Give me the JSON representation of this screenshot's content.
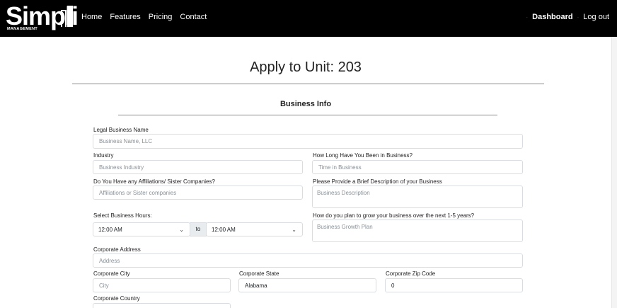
{
  "navbar": {
    "logo_text": "Simpli",
    "logo_subtext": "MANAGEMENT",
    "links": [
      "Home",
      "Features",
      "Pricing",
      "Contact"
    ],
    "dashboard_label": "Dashboard",
    "logout_label": "Log out",
    "separator": "·"
  },
  "page": {
    "title": "Apply to Unit: 203",
    "section_title": "Business Info"
  },
  "form": {
    "legal_name": {
      "label": "Legal Business Name",
      "placeholder": "Business Name, LLC"
    },
    "industry": {
      "label": "Industry",
      "placeholder": "Business Industry"
    },
    "time_in_business": {
      "label": "How Long Have You Been in Business?",
      "placeholder": "Time in Business"
    },
    "affiliations": {
      "label": "Do You Have any Affiliations/ Sister Companies?",
      "placeholder": "Affiliations or Sister companies"
    },
    "description": {
      "label": "Please Provide a Brief Description of your Business",
      "placeholder": "Business Description"
    },
    "hours": {
      "label": "Select Business Hours:",
      "open_value": "12:00 AM",
      "to_label": "to",
      "close_value": "12:00 AM"
    },
    "growth": {
      "label": "How do you plan to grow your business over the next 1-5 years?",
      "placeholder": "Business Growth Plan"
    },
    "address": {
      "label": "Corporate Address",
      "placeholder": "Address"
    },
    "city": {
      "label": "Corporate City",
      "placeholder": "City"
    },
    "state": {
      "label": "Corporate State",
      "value": "Alabama"
    },
    "zip": {
      "label": "Corporate Zip Code",
      "value": "0"
    },
    "country": {
      "label": "Corporate Country"
    }
  },
  "icons": {
    "chevron": "chevron-down-icon"
  }
}
